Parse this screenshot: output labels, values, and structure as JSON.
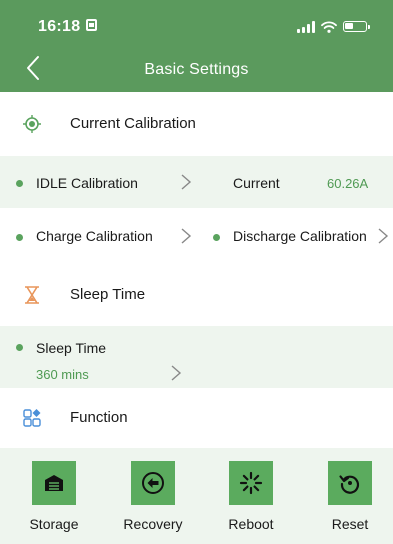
{
  "status": {
    "time": "16:18"
  },
  "nav": {
    "title": "Basic Settings"
  },
  "sections": {
    "current": {
      "label": "Current Calibration"
    },
    "sleep": {
      "label": "Sleep Time"
    },
    "function": {
      "label": "Function"
    }
  },
  "calibration": {
    "idle_label": "IDLE Calibration",
    "current_label": "Current",
    "current_value": "60.26A",
    "charge_label": "Charge Calibration",
    "discharge_label": "Discharge Calibration"
  },
  "sleep": {
    "label": "Sleep Time",
    "value": "360 mins"
  },
  "functions": {
    "storage": "Storage",
    "recovery": "Recovery",
    "reboot": "Reboot",
    "reset": "Reset"
  },
  "colors": {
    "brand": "#5b9a5d",
    "accent": "#5aa35e",
    "panel": "#eef5ee",
    "value": "#4f9a53"
  }
}
